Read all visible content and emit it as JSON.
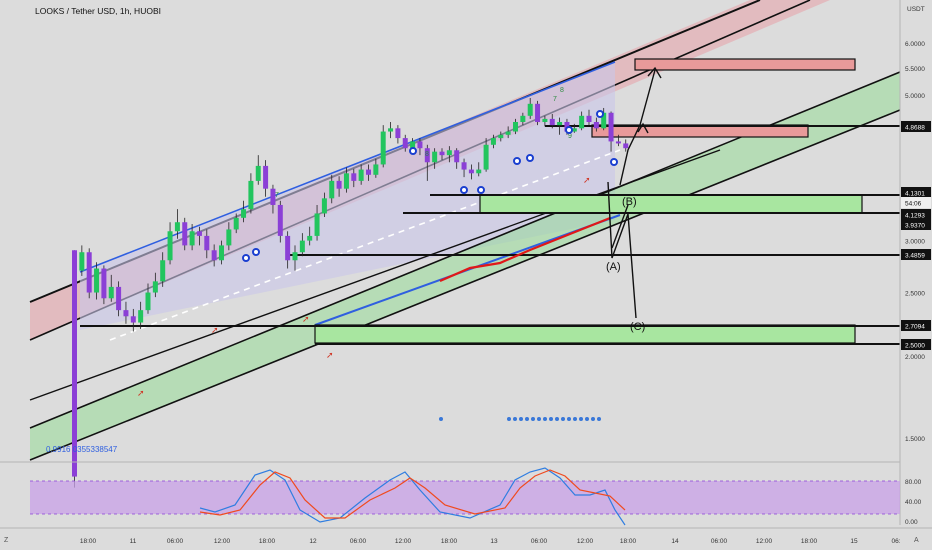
{
  "title": "LOOKS / Tether USD, 1h, HUOBI",
  "colors": {
    "background": "#dcdcdc",
    "up": "#22c55e",
    "down": "#8b3fd6",
    "upper_channel": "#e8a0a8",
    "lower_channel": "#8fdc8f",
    "inner_channel": "#c9c6ea",
    "stoch_band": "#c9a2e8",
    "stoch_k": "#2f7de1",
    "stoch_d": "#f04a1e",
    "resistance_zone": "#e89a9a",
    "support_zone": "#a8e6a0",
    "moving_average": "#e01818"
  },
  "chart_data": {
    "type": "candlestick",
    "title": "LOOKS / Tether USD, 1h, HUOBI",
    "y_axis": {
      "unit_label": "USDT",
      "scale": "log",
      "ticks": [
        "6.0000",
        "5.5000",
        "5.0000",
        "4.5000",
        "3.0000",
        "2.5000",
        "2.0000",
        "1.5000"
      ],
      "range": [
        1.26,
        6.3
      ]
    },
    "x_axis": {
      "ticks": [
        "18:00",
        "11",
        "06:00",
        "12:00",
        "18:00",
        "12",
        "06:00",
        "12:00",
        "18:00",
        "13",
        "06:00",
        "12:00",
        "18:00",
        "14",
        "06:00",
        "12:00",
        "18:00",
        "15",
        "06:"
      ]
    },
    "price_labels": [
      "4.8688",
      "4.1301",
      "54:06",
      "4.1293",
      "3.9370",
      "3.4859",
      "2.7094",
      "2.5000"
    ],
    "horizontal_levels": [
      4.8688,
      4.1293,
      3.937,
      3.4859,
      2.7094,
      2.5
    ],
    "wave_labels": [
      "(B)",
      "(A)",
      "(C)"
    ],
    "fib_label": "0.9916 0355338547",
    "tick_marks": [
      "7",
      "8",
      "7",
      "8",
      "7",
      "8",
      "9"
    ],
    "stochastic": {
      "ticks": [
        "80.00",
        "40.00",
        "0.00"
      ],
      "band": [
        20,
        80
      ]
    },
    "candles": [
      [
        2.9,
        1.31,
        2.9,
        1.26
      ],
      [
        2.7,
        2.88,
        2.95,
        2.65
      ],
      [
        2.88,
        2.5,
        2.92,
        2.45
      ],
      [
        2.5,
        2.72,
        2.78,
        2.44
      ],
      [
        2.72,
        2.45,
        2.75,
        2.4
      ],
      [
        2.45,
        2.55,
        2.66,
        2.42
      ],
      [
        2.55,
        2.35,
        2.6,
        2.3
      ],
      [
        2.35,
        2.3,
        2.42,
        2.24
      ],
      [
        2.3,
        2.25,
        2.36,
        2.18
      ],
      [
        2.25,
        2.35,
        2.42,
        2.2
      ],
      [
        2.35,
        2.5,
        2.58,
        2.32
      ],
      [
        2.5,
        2.6,
        2.68,
        2.46
      ],
      [
        2.6,
        2.8,
        2.88,
        2.55
      ],
      [
        2.8,
        3.1,
        3.2,
        2.76
      ],
      [
        3.1,
        3.2,
        3.35,
        3.02
      ],
      [
        3.2,
        2.95,
        3.25,
        2.9
      ],
      [
        2.95,
        3.1,
        3.18,
        2.9
      ],
      [
        3.1,
        3.05,
        3.15,
        2.95
      ],
      [
        3.05,
        2.9,
        3.12,
        2.82
      ],
      [
        2.9,
        2.8,
        2.96,
        2.74
      ],
      [
        2.8,
        2.95,
        3.0,
        2.76
      ],
      [
        2.95,
        3.12,
        3.2,
        2.9
      ],
      [
        3.12,
        3.25,
        3.3,
        3.08
      ],
      [
        3.25,
        3.35,
        3.45,
        3.2
      ],
      [
        3.35,
        3.7,
        3.8,
        3.3
      ],
      [
        3.7,
        3.9,
        4.05,
        3.65
      ],
      [
        3.9,
        3.6,
        3.98,
        3.5
      ],
      [
        3.6,
        3.4,
        3.65,
        3.3
      ],
      [
        3.4,
        3.05,
        3.45,
        2.98
      ],
      [
        3.05,
        2.8,
        3.1,
        2.72
      ],
      [
        2.8,
        2.88,
        2.95,
        2.7
      ],
      [
        2.88,
        3.0,
        3.08,
        2.84
      ],
      [
        3.0,
        3.05,
        3.15,
        2.95
      ],
      [
        3.05,
        3.3,
        3.4,
        3.0
      ],
      [
        3.3,
        3.48,
        3.55,
        3.26
      ],
      [
        3.48,
        3.7,
        3.78,
        3.42
      ],
      [
        3.7,
        3.6,
        3.76,
        3.5
      ],
      [
        3.6,
        3.8,
        3.88,
        3.55
      ],
      [
        3.8,
        3.7,
        3.86,
        3.62
      ],
      [
        3.7,
        3.85,
        3.92,
        3.65
      ],
      [
        3.85,
        3.78,
        3.92,
        3.7
      ],
      [
        3.78,
        3.92,
        4.0,
        3.74
      ],
      [
        3.92,
        4.4,
        4.5,
        3.88
      ],
      [
        4.4,
        4.45,
        4.55,
        4.3
      ],
      [
        4.45,
        4.3,
        4.5,
        4.22
      ],
      [
        4.3,
        4.15,
        4.35,
        4.1
      ],
      [
        4.15,
        4.25,
        4.3,
        4.1
      ],
      [
        4.25,
        4.15,
        4.3,
        4.05
      ],
      [
        4.15,
        3.95,
        4.2,
        3.7
      ],
      [
        3.95,
        4.1,
        4.15,
        3.86
      ],
      [
        4.1,
        4.05,
        4.15,
        3.98
      ],
      [
        4.05,
        4.12,
        4.18,
        3.95
      ],
      [
        4.12,
        3.95,
        4.15,
        3.86
      ],
      [
        3.95,
        3.85,
        4.0,
        3.75
      ],
      [
        3.85,
        3.8,
        3.92,
        3.72
      ],
      [
        3.8,
        3.85,
        3.95,
        3.76
      ],
      [
        3.85,
        4.2,
        4.3,
        3.82
      ],
      [
        4.2,
        4.3,
        4.35,
        4.15
      ],
      [
        4.3,
        4.35,
        4.4,
        4.25
      ],
      [
        4.35,
        4.4,
        4.48,
        4.3
      ],
      [
        4.4,
        4.55,
        4.6,
        4.36
      ],
      [
        4.55,
        4.65,
        4.7,
        4.5
      ],
      [
        4.65,
        4.85,
        4.95,
        4.6
      ],
      [
        4.85,
        4.55,
        4.9,
        4.5
      ],
      [
        4.55,
        4.6,
        4.65,
        4.48
      ],
      [
        4.6,
        4.5,
        4.68,
        4.45
      ],
      [
        4.5,
        4.55,
        4.62,
        4.35
      ],
      [
        4.55,
        4.4,
        4.6,
        4.35
      ],
      [
        4.4,
        4.45,
        4.52,
        4.38
      ],
      [
        4.45,
        4.65,
        4.72,
        4.42
      ],
      [
        4.65,
        4.55,
        4.75,
        4.5
      ],
      [
        4.55,
        4.45,
        4.62,
        4.4
      ],
      [
        4.45,
        4.7,
        4.78,
        4.42
      ],
      [
        4.7,
        4.25,
        4.72,
        4.1
      ],
      [
        4.25,
        4.22,
        4.35,
        4.18
      ],
      [
        4.22,
        4.15,
        4.28,
        4.1
      ]
    ]
  }
}
